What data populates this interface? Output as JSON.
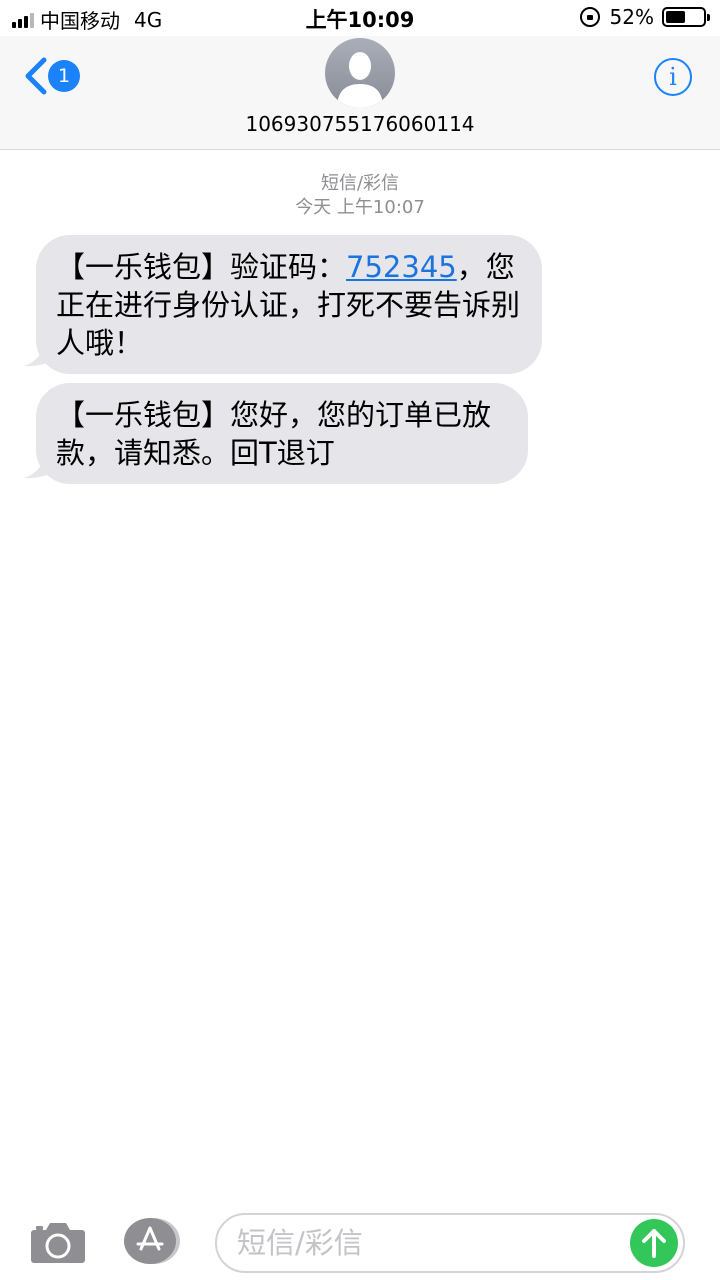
{
  "status_bar": {
    "carrier": "中国移动",
    "network": "4G",
    "time": "上午10:09",
    "battery_percent": "52%",
    "battery_level": 0.52
  },
  "header": {
    "back_badge_count": "1",
    "contact_name": "106930755176060114",
    "info_label": "i"
  },
  "conversation": {
    "message_type": "短信/彩信",
    "timestamp": "今天 上午10:07",
    "messages": [
      {
        "text_before_code": "【一乐钱包】验证码：",
        "code": "752345",
        "text_after_code": "，您正在进行身份认证，打死不要告诉别人哦！"
      },
      {
        "text": "【一乐钱包】您好，您的订单已放款，请知悉。回T退订"
      }
    ]
  },
  "composer": {
    "placeholder": "短信/彩信"
  },
  "colors": {
    "accent": "#1a82fb",
    "bubble": "#e5e5ea",
    "send": "#33c759"
  },
  "icons": [
    "signal-icon",
    "rotation-lock-icon",
    "battery-icon",
    "back-chevron-icon",
    "avatar-icon",
    "info-icon",
    "camera-icon",
    "app-store-icon",
    "send-arrow-icon"
  ]
}
